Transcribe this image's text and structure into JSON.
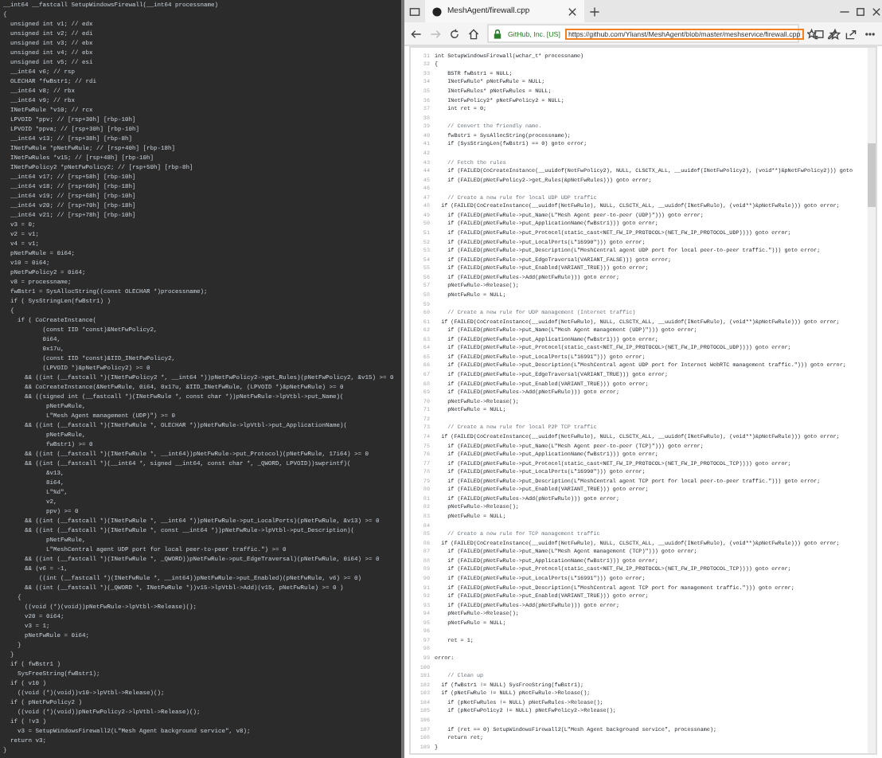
{
  "decompiler": {
    "lines": [
      {
        "text": "__int64 __fastcall SetupWindowsFirewall(__int64 processname)"
      },
      {
        "text": "{"
      },
      {
        "text": "  unsigned int v1; // edx"
      },
      {
        "text": "  unsigned int v2; // edi"
      },
      {
        "text": "  unsigned int v3; // ebx"
      },
      {
        "text": "  unsigned int v4; // ebx"
      },
      {
        "text": "  unsigned int v5; // esi"
      },
      {
        "text": "  __int64 v6; // rsp"
      },
      {
        "text": "  OLECHAR *fwBstr1; // rdi"
      },
      {
        "text": "  __int64 v8; // rbx"
      },
      {
        "text": "  __int64 v9; // rbx"
      },
      {
        "text": "  INetFwRule *v10; // rcx"
      },
      {
        "text": "  LPVOID *ppv; // [rsp+30h] [rbp-10h]"
      },
      {
        "text": "  LPVOID *ppva; // [rsp+30h] [rbp-10h]"
      },
      {
        "text": "  __int64 v13; // [rsp+38h] [rbp-8h]"
      },
      {
        "text": "  INetFwRule *pNetFwRule; // [rsp+40h] [rbp-18h]"
      },
      {
        "text": "  INetFwRules *v15; // [rsp+48h] [rbp-10h]"
      },
      {
        "text": "  INetFwPolicy2 *pNetFwPolicy2; // [rsp+50h] [rbp-8h]"
      },
      {
        "text": "  __int64 v17; // [rsp+58h] [rbp-10h]"
      },
      {
        "text": "  __int64 v18; // [rsp+60h] [rbp-18h]"
      },
      {
        "text": "  __int64 v19; // [rsp+68h] [rbp-10h]"
      },
      {
        "text": "  __int64 v20; // [rsp+70h] [rbp-18h]"
      },
      {
        "text": "  __int64 v21; // [rsp+78h] [rbp-10h]"
      },
      {
        "text": "  v3 = 0;"
      },
      {
        "text": "  v2 = v1;"
      },
      {
        "text": "  v4 = v1;"
      },
      {
        "text": "  pNetFwRule = 0i64;"
      },
      {
        "text": "  v10 = 0i64;"
      },
      {
        "text": "  pNetFwPolicy2 = 0i64;"
      },
      {
        "text": "  v8 = processname;"
      },
      {
        "text": "  fwBstr1 = SysAllocString((const OLECHAR *)processname);"
      },
      {
        "text": "  if ( SysStringLen(fwBstr1) )"
      },
      {
        "text": "  {"
      },
      {
        "text": "    if ( CoCreateInstance("
      },
      {
        "text": "           (const IID *const)&NetFwPolicy2,"
      },
      {
        "text": "           0i64,"
      },
      {
        "text": "           0x17u,"
      },
      {
        "text": "           (const IID *const)&IID_INetFwPolicy2,"
      },
      {
        "text": "           (LPVOID *)&pNetFwPolicy2) >= 0"
      },
      {
        "text": "      && ((int (__fastcall *)(INetFwPolicy2 *, __int64 *))pNetFwPolicy2->get_Rules)(pNetFwPolicy2, &v15) >= 0"
      },
      {
        "text": "      && CoCreateInstance(&NetFwRule, 0i64, 0x17u, &IID_INetFwRule, (LPVOID *)&pNetFwRule) >= 0"
      },
      {
        "text": "      && ((signed int (__fastcall *)(INetFwRule *, const char *))pNetFwRule->lpVtbl->put_Name)("
      },
      {
        "text": "            pNetFwRule,"
      },
      {
        "text": "            L\"Mesh Agent management (UDP)\") >= 0"
      },
      {
        "text": "      && ((int (__fastcall *)(INetFwRule *, OLECHAR *))pNetFwRule->lpVtbl->put_ApplicationName)("
      },
      {
        "text": "            pNetFwRule,"
      },
      {
        "text": "            fwBstr1) >= 0"
      },
      {
        "text": "      && ((int (__fastcall *)(INetFwRule *, __int64))pNetFwRule->put_Protocol)(pNetFwRule, 17i64) >= 0"
      },
      {
        "text": "      && ((int (__fastcall *)(__int64 *, signed __int64, const char *, _QWORD, LPVOID))swprintf)("
      },
      {
        "text": "            &v13,"
      },
      {
        "text": "            8i64,"
      },
      {
        "text": "            L\"%d\","
      },
      {
        "text": "            v2,"
      },
      {
        "text": "            ppv) >= 0"
      },
      {
        "text": "      && ((int (__fastcall *)(INetFwRule *, __int64 *))pNetFwRule->put_LocalPorts)(pNetFwRule, &v13) >= 0"
      },
      {
        "text": "      && ((int (__fastcall *)(INetFwRule *, const __int64 *))pNetFwRule->lpVtbl->put_Description)("
      },
      {
        "text": "            pNetFwRule,"
      },
      {
        "text": "            L\"MeshCentral agent UDP port for local peer-to-peer traffic.\") >= 0"
      },
      {
        "text": "      && ((int (__fastcall *)(INetFwRule *, _QWORD))pNetFwRule->put_EdgeTraversal)(pNetFwRule, 0i64) >= 0"
      },
      {
        "text": "      && (v6 = -1,"
      },
      {
        "text": "          ((int (__fastcall *)(INetFwRule *, __int64))pNetFwRule->put_Enabled)(pNetFwRule, v6) >= 0)"
      },
      {
        "text": "      && ((int (__fastcall *)(_QWORD *, INetFwRule *))v15->lpVtbl->Add)(v15, pNetFwRule) >= 0 )"
      },
      {
        "text": "    {"
      },
      {
        "text": "      ((void (*)(void))pNetFwRule->lpVtbl->Release)();"
      },
      {
        "text": "      v20 = 0i64;"
      },
      {
        "text": "      v3 = 1;"
      },
      {
        "text": "      pNetFwRule = 0i64;"
      },
      {
        "text": "    }"
      },
      {
        "text": "  }"
      },
      {
        "text": "  if ( fwBstr1 )"
      },
      {
        "text": "    SysFreeString(fwBstr1);"
      },
      {
        "text": "  if ( v10 )"
      },
      {
        "text": "    ((void (*)(void))v10->lpVtbl->Release)();"
      },
      {
        "text": "  if ( pNetFwPolicy2 )"
      },
      {
        "text": "    ((void (*)(void))pNetFwPolicy2->lpVtbl->Release)();"
      },
      {
        "text": "  if ( !v3 )"
      },
      {
        "text": "    v3 = SetupWindowsFirewall2(L\"Mesh Agent background service\", v8);"
      },
      {
        "text": "  return v3;"
      },
      {
        "text": "}"
      }
    ]
  },
  "browser": {
    "tab": {
      "title": "MeshAgent/firewall.cpp"
    },
    "site_identity": "GitHub, Inc. [US]",
    "url": "https://github.com/Ylianst/MeshAgent/blob/master/meshservice/firewall.cpp",
    "code_lines": [
      {
        "number": "31",
        "kind": "code",
        "text": "int SetupWindowsFirewall(wchar_t* processname)"
      },
      {
        "number": "32",
        "kind": "code",
        "text": "{"
      },
      {
        "number": "33",
        "kind": "code",
        "text": "    BSTR fwBstr1 = NULL;"
      },
      {
        "number": "34",
        "kind": "code",
        "text": "    INetFwRule* pNetFwRule = NULL;"
      },
      {
        "number": "35",
        "kind": "code",
        "text": "    INetFwRules* pNetFwRules = NULL;"
      },
      {
        "number": "36",
        "kind": "code",
        "text": "    INetFwPolicy2* pNetFwPolicy2 = NULL;"
      },
      {
        "number": "37",
        "kind": "code",
        "text": "    int ret = 0;"
      },
      {
        "number": "38",
        "kind": "blank"
      },
      {
        "number": "39",
        "kind": "comment",
        "text": "    // Convert the friendly name."
      },
      {
        "number": "40",
        "kind": "code",
        "text": "    fwBstr1 = SysAllocString(processname);"
      },
      {
        "number": "41",
        "kind": "code",
        "text": "    if (SysStringLen(fwBstr1) == 0) goto error;"
      },
      {
        "number": "42",
        "kind": "blank"
      },
      {
        "number": "43",
        "kind": "comment",
        "text": "    // Fetch the rules"
      },
      {
        "number": "44",
        "kind": "code",
        "text": "    if (FAILED(CoCreateInstance(__uuidof(NetFwPolicy2), NULL, CLSCTX_ALL, __uuidof(INetFwPolicy2), (void**)&pNetFwPolicy2))) goto"
      },
      {
        "number": "45",
        "kind": "code",
        "text": "    if (FAILED(pNetFwPolicy2->get_Rules(&pNetFwRules))) goto error;"
      },
      {
        "number": "46",
        "kind": "blank"
      },
      {
        "number": "47",
        "kind": "comment",
        "text": "    // Create a new rule for local UDP UDP traffic"
      },
      {
        "number": "48",
        "kind": "code",
        "text": "  if (FAILED(CoCreateInstance(__uuidof(NetFwRule), NULL, CLSCTX_ALL, __uuidof(INetFwRule), (void**)&pNetFwRule))) goto error;"
      },
      {
        "number": "49",
        "kind": "code",
        "text": "    if (FAILED(pNetFwRule->put_Name(L\"Mesh Agent peer-to-peer (UDP)\"))) goto error;"
      },
      {
        "number": "50",
        "kind": "code",
        "text": "    if (FAILED(pNetFwRule->put_ApplicationName(fwBstr1))) goto error;"
      },
      {
        "number": "51",
        "kind": "code",
        "text": "    if (FAILED(pNetFwRule->put_Protocol(static_cast<NET_FW_IP_PROTOCOL>(NET_FW_IP_PROTOCOL_UDP)))) goto error;"
      },
      {
        "number": "52",
        "kind": "code",
        "text": "    if (FAILED(pNetFwRule->put_LocalPorts(L\"16990\"))) goto error;"
      },
      {
        "number": "53",
        "kind": "code",
        "text": "    if (FAILED(pNetFwRule->put_Description(L\"MeshCentral agent UDP port for local peer-to-peer traffic.\"))) goto error;"
      },
      {
        "number": "54",
        "kind": "code",
        "text": "    if (FAILED(pNetFwRule->put_EdgeTraversal(VARIANT_FALSE))) goto error;"
      },
      {
        "number": "55",
        "kind": "code",
        "text": "    if (FAILED(pNetFwRule->put_Enabled(VARIANT_TRUE))) goto error;"
      },
      {
        "number": "56",
        "kind": "code",
        "text": "    if (FAILED(pNetFwRules->Add(pNetFwRule))) goto error;"
      },
      {
        "number": "57",
        "kind": "code",
        "text": "    pNetFwRule->Release();"
      },
      {
        "number": "58",
        "kind": "code",
        "text": "    pNetFwRule = NULL;"
      },
      {
        "number": "59",
        "kind": "blank"
      },
      {
        "number": "60",
        "kind": "comment",
        "text": "    // Create a new rule for UDP management (Internet traffic)"
      },
      {
        "number": "61",
        "kind": "code",
        "text": "  if (FAILED(CoCreateInstance(__uuidof(NetFwRule), NULL, CLSCTX_ALL, __uuidof(INetFwRule), (void**)&pNetFwRule))) goto error;"
      },
      {
        "number": "62",
        "kind": "code",
        "text": "    if (FAILED(pNetFwRule->put_Name(L\"Mesh Agent management (UDP)\"))) goto error;"
      },
      {
        "number": "63",
        "kind": "code",
        "text": "    if (FAILED(pNetFwRule->put_ApplicationName(fwBstr1))) goto error;"
      },
      {
        "number": "64",
        "kind": "code",
        "text": "    if (FAILED(pNetFwRule->put_Protocol(static_cast<NET_FW_IP_PROTOCOL>(NET_FW_IP_PROTOCOL_UDP)))) goto error;"
      },
      {
        "number": "65",
        "kind": "code",
        "text": "    if (FAILED(pNetFwRule->put_LocalPorts(L\"16991\"))) goto error;"
      },
      {
        "number": "66",
        "kind": "code",
        "text": "    if (FAILED(pNetFwRule->put_Description(L\"MeshCentral agent UDP port for Internet WebRTC management traffic.\"))) goto error;"
      },
      {
        "number": "67",
        "kind": "code",
        "text": "    if (FAILED(pNetFwRule->put_EdgeTraversal(VARIANT_TRUE))) goto error;"
      },
      {
        "number": "68",
        "kind": "code",
        "text": "    if (FAILED(pNetFwRule->put_Enabled(VARIANT_TRUE))) goto error;"
      },
      {
        "number": "69",
        "kind": "code",
        "text": "    if (FAILED(pNetFwRules->Add(pNetFwRule))) goto error;"
      },
      {
        "number": "70",
        "kind": "code",
        "text": "    pNetFwRule->Release();"
      },
      {
        "number": "71",
        "kind": "code",
        "text": "    pNetFwRule = NULL;"
      },
      {
        "number": "72",
        "kind": "blank"
      },
      {
        "number": "73",
        "kind": "comment",
        "text": "    // Create a new rule for local P2P TCP traffic"
      },
      {
        "number": "74",
        "kind": "code",
        "text": "  if (FAILED(CoCreateInstance(__uuidof(NetFwRule), NULL, CLSCTX_ALL, __uuidof(INetFwRule), (void**)&pNetFwRule))) goto error;"
      },
      {
        "number": "75",
        "kind": "code",
        "text": "    if (FAILED(pNetFwRule->put_Name(L\"Mesh Agent peer-to-peer (TCP)\"))) goto error;"
      },
      {
        "number": "76",
        "kind": "code",
        "text": "    if (FAILED(pNetFwRule->put_ApplicationName(fwBstr1))) goto error;"
      },
      {
        "number": "77",
        "kind": "code",
        "text": "    if (FAILED(pNetFwRule->put_Protocol(static_cast<NET_FW_IP_PROTOCOL>(NET_FW_IP_PROTOCOL_TCP)))) goto error;"
      },
      {
        "number": "78",
        "kind": "code",
        "text": "    if (FAILED(pNetFwRule->put_LocalPorts(L\"16990\"))) goto error;"
      },
      {
        "number": "79",
        "kind": "code",
        "text": "    if (FAILED(pNetFwRule->put_Description(L\"MeshCentral agent TCP port for local peer-to-peer traffic.\"))) goto error;"
      },
      {
        "number": "80",
        "kind": "code",
        "text": "    if (FAILED(pNetFwRule->put_Enabled(VARIANT_TRUE))) goto error;"
      },
      {
        "number": "81",
        "kind": "code",
        "text": "    if (FAILED(pNetFwRules->Add(pNetFwRule))) goto error;"
      },
      {
        "number": "82",
        "kind": "code",
        "text": "    pNetFwRule->Release();"
      },
      {
        "number": "83",
        "kind": "code",
        "text": "    pNetFwRule = NULL;"
      },
      {
        "number": "84",
        "kind": "blank"
      },
      {
        "number": "85",
        "kind": "comment",
        "text": "    // Create a new rule for TCP management traffic"
      },
      {
        "number": "86",
        "kind": "code",
        "text": "  if (FAILED(CoCreateInstance(__uuidof(NetFwRule), NULL, CLSCTX_ALL, __uuidof(INetFwRule), (void**)&pNetFwRule))) goto error;"
      },
      {
        "number": "87",
        "kind": "code",
        "text": "    if (FAILED(pNetFwRule->put_Name(L\"Mesh Agent management (TCP)\"))) goto error;"
      },
      {
        "number": "88",
        "kind": "code",
        "text": "    if (FAILED(pNetFwRule->put_ApplicationName(fwBstr1))) goto error;"
      },
      {
        "number": "89",
        "kind": "code",
        "text": "    if (FAILED(pNetFwRule->put_Protocol(static_cast<NET_FW_IP_PROTOCOL>(NET_FW_IP_PROTOCOL_TCP)))) goto error;"
      },
      {
        "number": "90",
        "kind": "code",
        "text": "    if (FAILED(pNetFwRule->put_LocalPorts(L\"16991\"))) goto error;"
      },
      {
        "number": "91",
        "kind": "code",
        "text": "    if (FAILED(pNetFwRule->put_Description(L\"MeshCentral agent TCP port for management traffic.\"))) goto error;"
      },
      {
        "number": "92",
        "kind": "code",
        "text": "    if (FAILED(pNetFwRule->put_Enabled(VARIANT_TRUE))) goto error;"
      },
      {
        "number": "93",
        "kind": "code",
        "text": "    if (FAILED(pNetFwRules->Add(pNetFwRule))) goto error;"
      },
      {
        "number": "94",
        "kind": "code",
        "text": "    pNetFwRule->Release();"
      },
      {
        "number": "95",
        "kind": "code",
        "text": "    pNetFwRule = NULL;"
      },
      {
        "number": "96",
        "kind": "blank"
      },
      {
        "number": "97",
        "kind": "code",
        "text": "    ret = 1;"
      },
      {
        "number": "98",
        "kind": "blank"
      },
      {
        "number": "99",
        "kind": "code",
        "text": "error:"
      },
      {
        "number": "100",
        "kind": "blank"
      },
      {
        "number": "101",
        "kind": "comment",
        "text": "    // Clean up"
      },
      {
        "number": "102",
        "kind": "code",
        "text": "  if (fwBstr1 != NULL) SysFreeString(fwBstr1);"
      },
      {
        "number": "103",
        "kind": "code",
        "text": "  if (pNetFwRule != NULL) pNetFwRule->Release();"
      },
      {
        "number": "104",
        "kind": "code",
        "text": "    if (pNetFwRules != NULL) pNetFwRules->Release();"
      },
      {
        "number": "105",
        "kind": "code",
        "text": "    if (pNetFwPolicy2 != NULL) pNetFwPolicy2->Release();"
      },
      {
        "number": "106",
        "kind": "blank"
      },
      {
        "number": "107",
        "kind": "code",
        "text": "    if (ret == 0) SetupWindowsFirewall2(L\"Mesh Agent background service\", processname);"
      },
      {
        "number": "108",
        "kind": "code",
        "text": "    return ret;"
      },
      {
        "number": "109",
        "kind": "code",
        "text": "}"
      }
    ]
  }
}
